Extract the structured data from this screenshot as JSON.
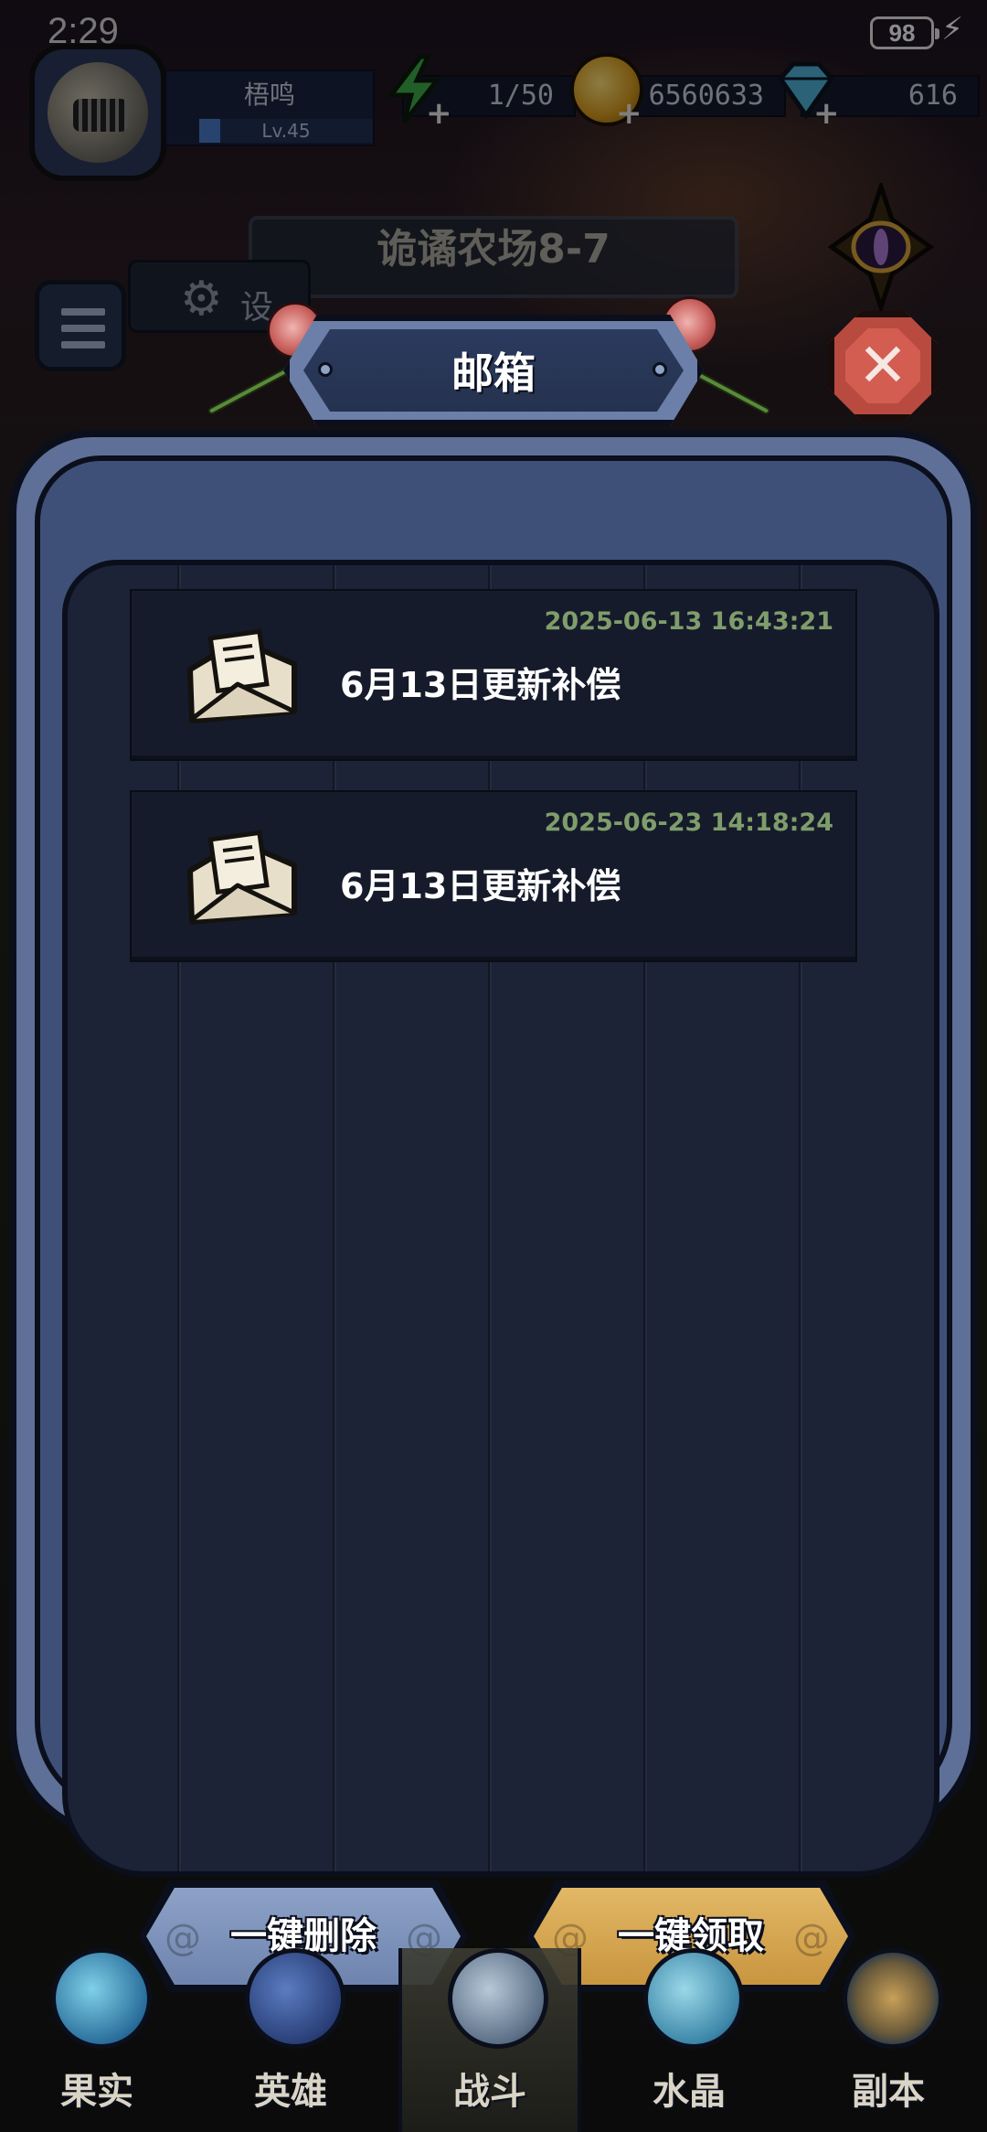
{
  "status_bar": {
    "time": "2:29",
    "battery": "98"
  },
  "player": {
    "name": "梧鸣",
    "level": "Lv.45",
    "level_progress": 0.12
  },
  "resources": {
    "energy": "1/50",
    "gold": "6560633",
    "gems": "616"
  },
  "stage": {
    "title": "诡谲农场8-7"
  },
  "settings_tab": {
    "label": "设"
  },
  "mailbox": {
    "title": "邮箱",
    "mails": [
      {
        "time": "2025-06-13 16:43:21",
        "subject": "6月13日更新补偿"
      },
      {
        "time": "2025-06-23 14:18:24",
        "subject": "6月13日更新补偿"
      }
    ],
    "delete_all_label": "一键删除",
    "claim_all_label": "一键领取"
  },
  "nav": {
    "items": [
      {
        "label": "果实"
      },
      {
        "label": "英雄"
      },
      {
        "label": "战斗"
      },
      {
        "label": "水晶"
      },
      {
        "label": "副本"
      }
    ]
  },
  "colors": {
    "frame_blue": "#5e7098",
    "panel_dark": "#1c2336",
    "mail_time_green": "#7f9d6c",
    "claim_gold": "#d6a852",
    "close_red": "#b84a3f"
  }
}
